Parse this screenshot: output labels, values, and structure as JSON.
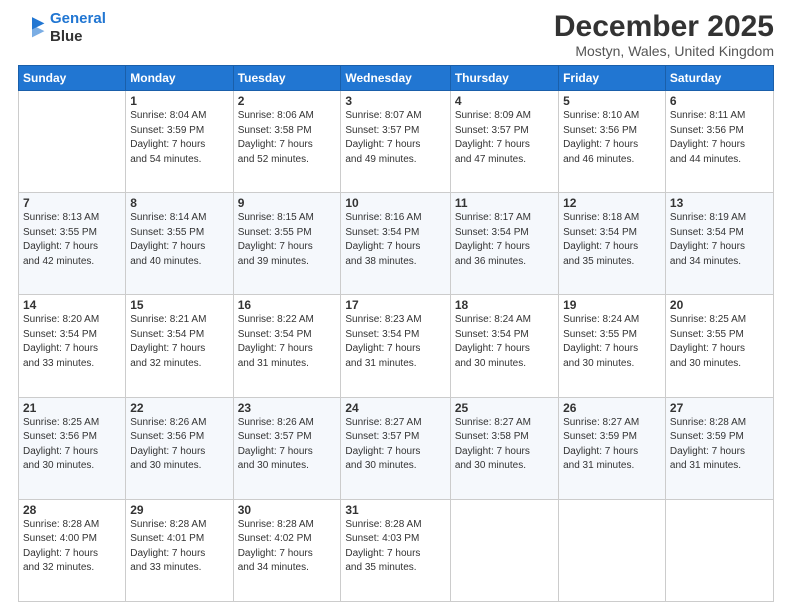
{
  "header": {
    "logo_line1": "General",
    "logo_line2": "Blue",
    "month_title": "December 2025",
    "subtitle": "Mostyn, Wales, United Kingdom"
  },
  "days_of_week": [
    "Sunday",
    "Monday",
    "Tuesday",
    "Wednesday",
    "Thursday",
    "Friday",
    "Saturday"
  ],
  "weeks": [
    [
      {
        "num": "",
        "info": ""
      },
      {
        "num": "1",
        "info": "Sunrise: 8:04 AM\nSunset: 3:59 PM\nDaylight: 7 hours\nand 54 minutes."
      },
      {
        "num": "2",
        "info": "Sunrise: 8:06 AM\nSunset: 3:58 PM\nDaylight: 7 hours\nand 52 minutes."
      },
      {
        "num": "3",
        "info": "Sunrise: 8:07 AM\nSunset: 3:57 PM\nDaylight: 7 hours\nand 49 minutes."
      },
      {
        "num": "4",
        "info": "Sunrise: 8:09 AM\nSunset: 3:57 PM\nDaylight: 7 hours\nand 47 minutes."
      },
      {
        "num": "5",
        "info": "Sunrise: 8:10 AM\nSunset: 3:56 PM\nDaylight: 7 hours\nand 46 minutes."
      },
      {
        "num": "6",
        "info": "Sunrise: 8:11 AM\nSunset: 3:56 PM\nDaylight: 7 hours\nand 44 minutes."
      }
    ],
    [
      {
        "num": "7",
        "info": "Sunrise: 8:13 AM\nSunset: 3:55 PM\nDaylight: 7 hours\nand 42 minutes."
      },
      {
        "num": "8",
        "info": "Sunrise: 8:14 AM\nSunset: 3:55 PM\nDaylight: 7 hours\nand 40 minutes."
      },
      {
        "num": "9",
        "info": "Sunrise: 8:15 AM\nSunset: 3:55 PM\nDaylight: 7 hours\nand 39 minutes."
      },
      {
        "num": "10",
        "info": "Sunrise: 8:16 AM\nSunset: 3:54 PM\nDaylight: 7 hours\nand 38 minutes."
      },
      {
        "num": "11",
        "info": "Sunrise: 8:17 AM\nSunset: 3:54 PM\nDaylight: 7 hours\nand 36 minutes."
      },
      {
        "num": "12",
        "info": "Sunrise: 8:18 AM\nSunset: 3:54 PM\nDaylight: 7 hours\nand 35 minutes."
      },
      {
        "num": "13",
        "info": "Sunrise: 8:19 AM\nSunset: 3:54 PM\nDaylight: 7 hours\nand 34 minutes."
      }
    ],
    [
      {
        "num": "14",
        "info": "Sunrise: 8:20 AM\nSunset: 3:54 PM\nDaylight: 7 hours\nand 33 minutes."
      },
      {
        "num": "15",
        "info": "Sunrise: 8:21 AM\nSunset: 3:54 PM\nDaylight: 7 hours\nand 32 minutes."
      },
      {
        "num": "16",
        "info": "Sunrise: 8:22 AM\nSunset: 3:54 PM\nDaylight: 7 hours\nand 31 minutes."
      },
      {
        "num": "17",
        "info": "Sunrise: 8:23 AM\nSunset: 3:54 PM\nDaylight: 7 hours\nand 31 minutes."
      },
      {
        "num": "18",
        "info": "Sunrise: 8:24 AM\nSunset: 3:54 PM\nDaylight: 7 hours\nand 30 minutes."
      },
      {
        "num": "19",
        "info": "Sunrise: 8:24 AM\nSunset: 3:55 PM\nDaylight: 7 hours\nand 30 minutes."
      },
      {
        "num": "20",
        "info": "Sunrise: 8:25 AM\nSunset: 3:55 PM\nDaylight: 7 hours\nand 30 minutes."
      }
    ],
    [
      {
        "num": "21",
        "info": "Sunrise: 8:25 AM\nSunset: 3:56 PM\nDaylight: 7 hours\nand 30 minutes."
      },
      {
        "num": "22",
        "info": "Sunrise: 8:26 AM\nSunset: 3:56 PM\nDaylight: 7 hours\nand 30 minutes."
      },
      {
        "num": "23",
        "info": "Sunrise: 8:26 AM\nSunset: 3:57 PM\nDaylight: 7 hours\nand 30 minutes."
      },
      {
        "num": "24",
        "info": "Sunrise: 8:27 AM\nSunset: 3:57 PM\nDaylight: 7 hours\nand 30 minutes."
      },
      {
        "num": "25",
        "info": "Sunrise: 8:27 AM\nSunset: 3:58 PM\nDaylight: 7 hours\nand 30 minutes."
      },
      {
        "num": "26",
        "info": "Sunrise: 8:27 AM\nSunset: 3:59 PM\nDaylight: 7 hours\nand 31 minutes."
      },
      {
        "num": "27",
        "info": "Sunrise: 8:28 AM\nSunset: 3:59 PM\nDaylight: 7 hours\nand 31 minutes."
      }
    ],
    [
      {
        "num": "28",
        "info": "Sunrise: 8:28 AM\nSunset: 4:00 PM\nDaylight: 7 hours\nand 32 minutes."
      },
      {
        "num": "29",
        "info": "Sunrise: 8:28 AM\nSunset: 4:01 PM\nDaylight: 7 hours\nand 33 minutes."
      },
      {
        "num": "30",
        "info": "Sunrise: 8:28 AM\nSunset: 4:02 PM\nDaylight: 7 hours\nand 34 minutes."
      },
      {
        "num": "31",
        "info": "Sunrise: 8:28 AM\nSunset: 4:03 PM\nDaylight: 7 hours\nand 35 minutes."
      },
      {
        "num": "",
        "info": ""
      },
      {
        "num": "",
        "info": ""
      },
      {
        "num": "",
        "info": ""
      }
    ]
  ]
}
